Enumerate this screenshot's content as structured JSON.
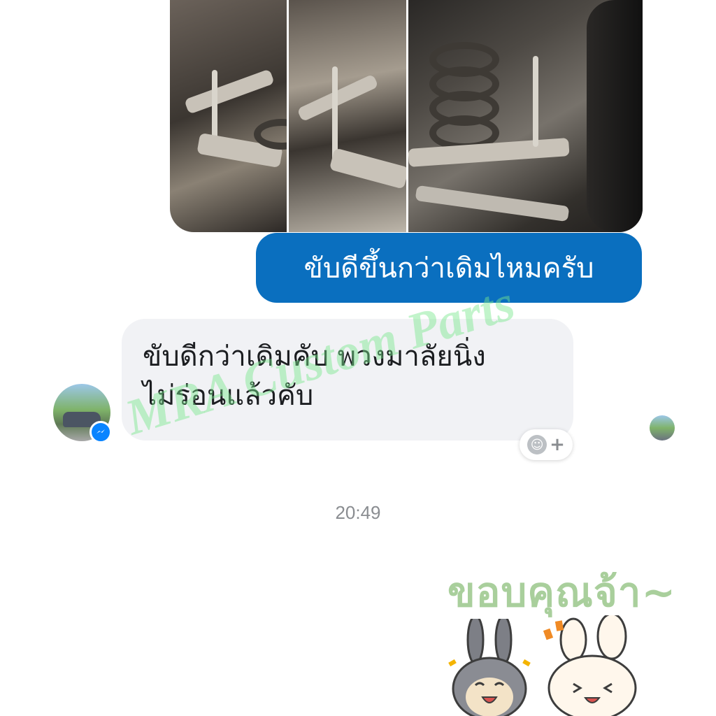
{
  "messages": {
    "outgoing_text": "ขับดีขึ้นกว่าเดิมไหมครับ",
    "incoming_lines": [
      "ขับดีกว่าเดิมคับ พวงมาลัยนิ่ง",
      "ไม่ร่อนแล้วคับ"
    ],
    "timestamp": "20:49",
    "sticker_text": "ขอบคุณจ้า~"
  },
  "watermark": "MRA Custom Parts",
  "icons": {
    "reaction": "smile-icon",
    "reaction_add": "plus-icon",
    "badge": "messenger-icon"
  },
  "colors": {
    "outgoing_bubble": "#0a6fbf",
    "incoming_bubble": "#f1f2f5",
    "watermark": "#78e68c",
    "sticker_text": "#a9cf9c"
  }
}
